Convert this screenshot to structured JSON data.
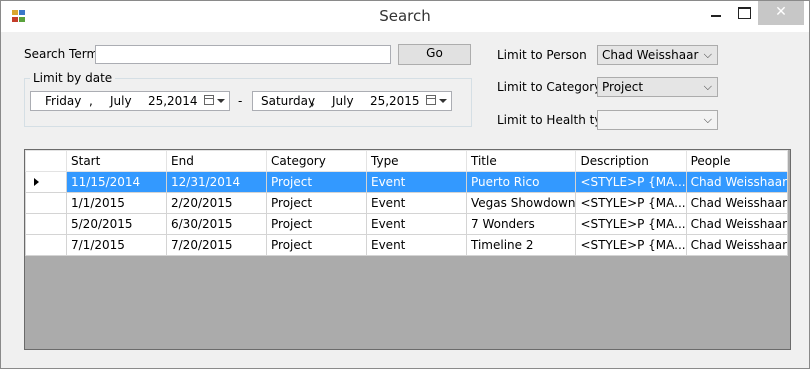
{
  "window": {
    "title": "Search"
  },
  "search": {
    "label": "Search Term",
    "value": "",
    "go_label": "Go"
  },
  "date_limit": {
    "group_label": "Limit by date",
    "separator": "-",
    "from": {
      "weekday": "Friday",
      "month": "July",
      "day": "25,",
      "year": "2014"
    },
    "to": {
      "weekday": "Saturday",
      "month": "July",
      "day": "25,",
      "year": "2015"
    }
  },
  "filters": {
    "person_label": "Limit to Person",
    "person_value": "Chad Weisshaar",
    "category_label": "Limit to Category",
    "category_value": "Project",
    "health_label": "Limit to Health type",
    "health_value": ""
  },
  "grid": {
    "columns": [
      "Start",
      "End",
      "Category",
      "Type",
      "Title",
      "Description",
      "People"
    ],
    "rows": [
      [
        "11/15/2014",
        "12/31/2014",
        "Project",
        "Event",
        "Puerto Rico",
        "<STYLE>P {MA...",
        "Chad Weisshaar"
      ],
      [
        "1/1/2015",
        "2/20/2015",
        "Project",
        "Event",
        "Vegas Showdown",
        "<STYLE>P {MA...",
        "Chad Weisshaar"
      ],
      [
        "5/20/2015",
        "6/30/2015",
        "Project",
        "Event",
        "7 Wonders",
        "<STYLE>P {MA...",
        "Chad Weisshaar"
      ],
      [
        "7/1/2015",
        "7/20/2015",
        "Project",
        "Event",
        "Timeline 2",
        "<STYLE>P {MA...",
        "Chad Weisshaar"
      ]
    ]
  }
}
